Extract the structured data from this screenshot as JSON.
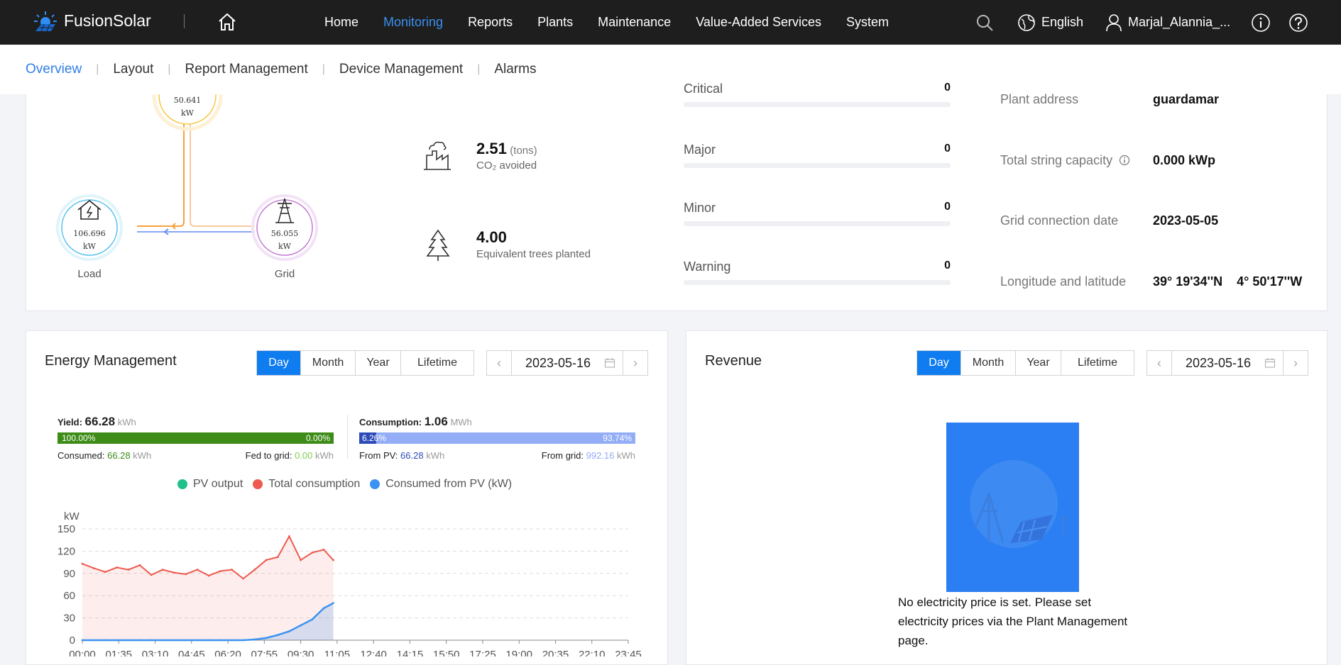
{
  "app": {
    "name": "FusionSolar"
  },
  "nav": {
    "items": [
      "Home",
      "Monitoring",
      "Reports",
      "Plants",
      "Maintenance",
      "Value-Added Services",
      "System"
    ],
    "active": "Monitoring"
  },
  "topbar": {
    "language": "English",
    "user": "Marjal_Alannia_..."
  },
  "subnav": {
    "items": [
      "Overview",
      "Layout",
      "Report Management",
      "Device Management",
      "Alarms"
    ],
    "active": "Overview"
  },
  "flow": {
    "pv_value": "50.641",
    "pv_unit": "kW",
    "load_value": "106.696",
    "load_unit": "kW",
    "load_label": "Load",
    "grid_value": "56.055",
    "grid_unit": "kW",
    "grid_label": "Grid"
  },
  "env": {
    "co2_value": "2.51",
    "co2_unit": "(tons)",
    "co2_label": "CO₂ avoided",
    "trees_value": "4.00",
    "trees_label": "Equivalent trees planted"
  },
  "alarms": [
    {
      "label": "Critical",
      "value": "0"
    },
    {
      "label": "Major",
      "value": "0"
    },
    {
      "label": "Minor",
      "value": "0"
    },
    {
      "label": "Warning",
      "value": "0"
    }
  ],
  "plant_info": [
    {
      "label": "Plant address",
      "value": "guardamar"
    },
    {
      "label": "Total string capacity",
      "value": "0.000 kWp"
    },
    {
      "label": "Grid connection date",
      "value": "2023-05-05"
    },
    {
      "label": "Longitude and latitude",
      "value": "39° 19'34''N    4° 50'17''W"
    }
  ],
  "energy": {
    "title": "Energy Management",
    "periods": [
      "Day",
      "Month",
      "Year",
      "Lifetime"
    ],
    "active_period": "Day",
    "date": "2023-05-16",
    "yield_label": "Yield:",
    "yield_value": "66.28",
    "yield_unit": "kWh",
    "yield_pct_left": "100.00%",
    "yield_pct_right": "0.00%",
    "consumed_label": "Consumed:",
    "consumed_value": "66.28",
    "consumed_unit": "kWh",
    "fed_label": "Fed to grid:",
    "fed_value": "0.00",
    "fed_unit": "kWh",
    "consumption_label": "Consumption:",
    "consumption_value": "1.06",
    "consumption_unit": "MWh",
    "cons_pct_left": "6.26%",
    "cons_pct_right": "93.74%",
    "from_pv_label": "From PV:",
    "from_pv_value": "66.28",
    "from_pv_unit": "kWh",
    "from_grid_label": "From grid:",
    "from_grid_value": "992.16",
    "from_grid_unit": "kWh",
    "yield_share": 1.0,
    "pv_share": 0.0626
  },
  "revenue": {
    "title": "Revenue",
    "periods": [
      "Day",
      "Month",
      "Year",
      "Lifetime"
    ],
    "active_period": "Day",
    "date": "2023-05-16",
    "message": "No electricity price is set. Please set electricity prices via the Plant Management page."
  },
  "colors": {
    "accent": "#0f7cf0",
    "yield_bar": "#3d8c17",
    "consumption_bar": "#93adf7",
    "pv_from": "#2d4bb8",
    "pv_output": "#1fc08a",
    "total_consumption": "#ee5a4f",
    "consumed_from_pv": "#3b93f1"
  },
  "chart_data": {
    "type": "line",
    "ylabel": "kW",
    "ylim": [
      0,
      150
    ],
    "yticks": [
      0,
      30,
      60,
      90,
      120,
      150
    ],
    "xticks": [
      "00:00",
      "01:35",
      "03:10",
      "04:45",
      "06:20",
      "07:55",
      "09:30",
      "11:05",
      "12:40",
      "14:15",
      "15:50",
      "17:25",
      "19:00",
      "20:35",
      "22:10",
      "23:45"
    ],
    "x_values": [
      "00:00",
      "00:30",
      "01:00",
      "01:30",
      "02:00",
      "02:30",
      "03:00",
      "03:30",
      "04:00",
      "04:30",
      "05:00",
      "05:30",
      "06:00",
      "06:30",
      "07:00",
      "07:30",
      "08:00",
      "08:30",
      "09:00",
      "09:30",
      "10:00",
      "10:30",
      "10:55"
    ],
    "series": [
      {
        "name": "PV output",
        "values": []
      },
      {
        "name": "Total consumption",
        "values": [
          103,
          97,
          92,
          98,
          95,
          101,
          88,
          95,
          91,
          89,
          95,
          87,
          93,
          95,
          83,
          95,
          108,
          112,
          140,
          108,
          118,
          122,
          108
        ]
      },
      {
        "name": "Consumed from PV (kW)",
        "values": [
          0,
          0,
          0,
          0,
          0,
          0,
          0,
          0,
          0,
          0,
          0,
          0,
          0,
          0,
          0,
          1,
          3,
          7,
          12,
          20,
          28,
          43,
          50
        ]
      }
    ],
    "legend": [
      "PV output",
      "Total consumption",
      "Consumed from PV (kW)"
    ]
  }
}
